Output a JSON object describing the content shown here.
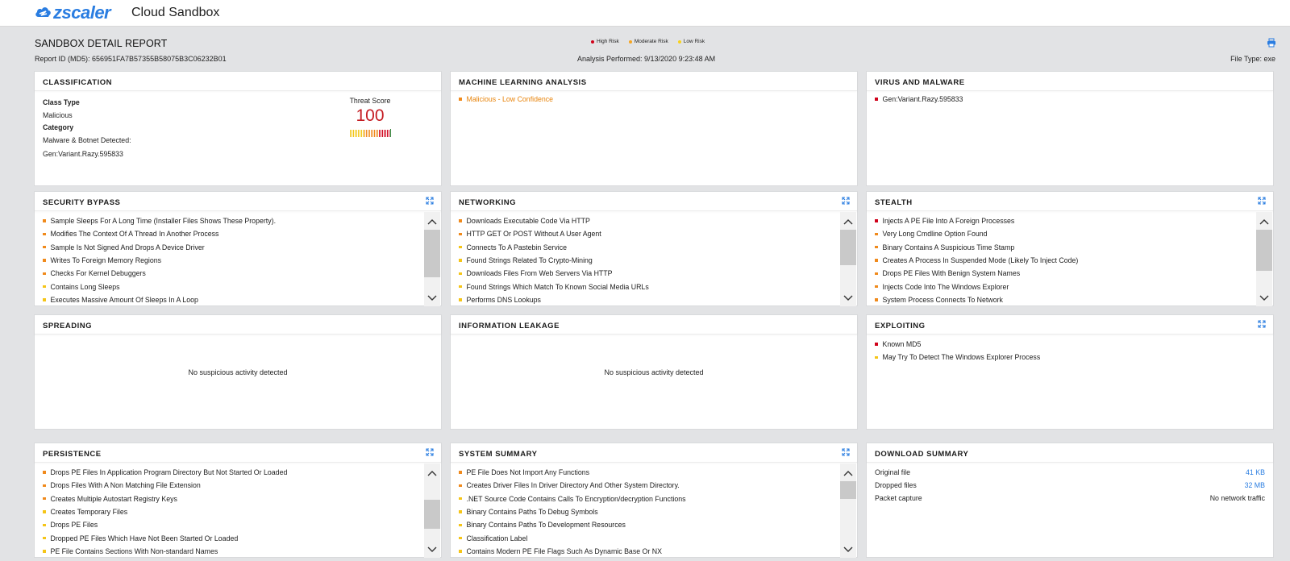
{
  "app": {
    "brand": "zscaler",
    "title": "Cloud Sandbox"
  },
  "report": {
    "title": "SANDBOX DETAIL REPORT",
    "report_id": "Report ID (MD5): 656951FA7B57355B58075B3C06232B01",
    "analysis": "Analysis Performed: 9/13/2020 9:23:48 AM",
    "file_type": "File Type: exe",
    "print_icon": "print-icon"
  },
  "legend": [
    {
      "label": "High Risk",
      "color": "#d0021b"
    },
    {
      "label": "Moderate Risk",
      "color": "#f5a623"
    },
    {
      "label": "Low Risk",
      "color": "#f8d21c"
    }
  ],
  "colors": {
    "high": "#d0021b",
    "moderate": "#f08a1c",
    "low": "#f5c518",
    "accent": "#2a7de1",
    "ml_text": "#e8840c"
  },
  "classification": {
    "title": "CLASSIFICATION",
    "class_type_label": "Class Type",
    "class_type_value": "Malicious",
    "category_label": "Category",
    "category_value": "Malware & Botnet Detected:",
    "detection": "Gen:Variant.Razy.595833",
    "threat_score_label": "Threat Score",
    "threat_score": "100",
    "threat_score_fraction": 1.0
  },
  "ml": {
    "title": "MACHINE LEARNING ANALYSIS",
    "item": "Malicious - Low Confidence",
    "risk": "moderate"
  },
  "virus": {
    "title": "VIRUS AND MALWARE",
    "item": "Gen:Variant.Razy.595833",
    "risk": "high"
  },
  "security_bypass": {
    "title": "SECURITY BYPASS",
    "items": [
      {
        "text": "Sample Sleeps For A Long Time (Installer Files Shows These Property).",
        "risk": "moderate"
      },
      {
        "text": "Modifies The Context Of A Thread In Another Process",
        "risk": "moderate"
      },
      {
        "text": "Sample Is Not Signed And Drops A Device Driver",
        "risk": "moderate"
      },
      {
        "text": "Writes To Foreign Memory Regions",
        "risk": "moderate"
      },
      {
        "text": "Checks For Kernel Debuggers",
        "risk": "moderate"
      },
      {
        "text": "Contains Long Sleeps",
        "risk": "low"
      },
      {
        "text": "Executes Massive Amount Of Sleeps In A Loop",
        "risk": "low"
      }
    ]
  },
  "networking": {
    "title": "NETWORKING",
    "items": [
      {
        "text": "Downloads Executable Code Via HTTP",
        "risk": "moderate"
      },
      {
        "text": "HTTP GET Or POST Without A User Agent",
        "risk": "moderate"
      },
      {
        "text": "Connects To A Pastebin Service",
        "risk": "low"
      },
      {
        "text": "Found Strings Related To Crypto-Mining",
        "risk": "low"
      },
      {
        "text": "Downloads Files From Web Servers Via HTTP",
        "risk": "low"
      },
      {
        "text": "Found Strings Which Match To Known Social Media URLs",
        "risk": "low"
      },
      {
        "text": "Performs DNS Lookups",
        "risk": "low"
      }
    ]
  },
  "stealth": {
    "title": "STEALTH",
    "items": [
      {
        "text": "Injects A PE File Into A Foreign Processes",
        "risk": "high"
      },
      {
        "text": "Very Long Cmdline Option Found",
        "risk": "moderate"
      },
      {
        "text": "Binary Contains A Suspicious Time Stamp",
        "risk": "moderate"
      },
      {
        "text": "Creates A Process In Suspended Mode (Likely To Inject Code)",
        "risk": "moderate"
      },
      {
        "text": "Drops PE Files With Benign System Names",
        "risk": "moderate"
      },
      {
        "text": "Injects Code Into The Windows Explorer",
        "risk": "moderate"
      },
      {
        "text": "System Process Connects To Network",
        "risk": "moderate"
      }
    ]
  },
  "spreading": {
    "title": "SPREADING",
    "message": "No suspicious activity detected"
  },
  "info_leakage": {
    "title": "INFORMATION LEAKAGE",
    "message": "No suspicious activity detected"
  },
  "exploiting": {
    "title": "EXPLOITING",
    "items": [
      {
        "text": "Known MD5",
        "risk": "high"
      },
      {
        "text": "May Try To Detect The Windows Explorer Process",
        "risk": "low"
      }
    ]
  },
  "persistence": {
    "title": "PERSISTENCE",
    "items": [
      {
        "text": "Drops PE Files In Application Program Directory But Not Started Or Loaded",
        "risk": "moderate"
      },
      {
        "text": "Drops Files With A Non Matching File Extension",
        "risk": "moderate"
      },
      {
        "text": "Creates Multiple Autostart Registry Keys",
        "risk": "moderate"
      },
      {
        "text": "Creates Temporary Files",
        "risk": "low"
      },
      {
        "text": "Drops PE Files",
        "risk": "low"
      },
      {
        "text": "Dropped PE Files Which Have Not Been Started Or Loaded",
        "risk": "low"
      },
      {
        "text": "PE File Contains Sections With Non-standard Names",
        "risk": "low"
      }
    ]
  },
  "system_summary": {
    "title": "SYSTEM SUMMARY",
    "items": [
      {
        "text": "PE File Does Not Import Any Functions",
        "risk": "moderate"
      },
      {
        "text": "Creates Driver Files In Driver Directory And Other System Directory.",
        "risk": "moderate"
      },
      {
        "text": ".NET Source Code Contains Calls To Encryption/decryption Functions",
        "risk": "low"
      },
      {
        "text": "Binary Contains Paths To Debug Symbols",
        "risk": "low"
      },
      {
        "text": "Binary Contains Paths To Development Resources",
        "risk": "low"
      },
      {
        "text": "Classification Label",
        "risk": "low"
      },
      {
        "text": "Contains Modern PE File Flags Such As Dynamic Base Or NX",
        "risk": "low"
      }
    ]
  },
  "download_summary": {
    "title": "DOWNLOAD SUMMARY",
    "rows": [
      {
        "label": "Original file",
        "value": "41 KB",
        "link": true
      },
      {
        "label": "Dropped files",
        "value": "32 MB",
        "link": true
      },
      {
        "label": "Packet capture",
        "value": "No network traffic",
        "link": false
      }
    ]
  },
  "icons": {
    "expand": "expand-icon",
    "scroll_up": "chevron-up-icon",
    "scroll_down": "chevron-down-icon",
    "bullet": "bullet-icon"
  }
}
